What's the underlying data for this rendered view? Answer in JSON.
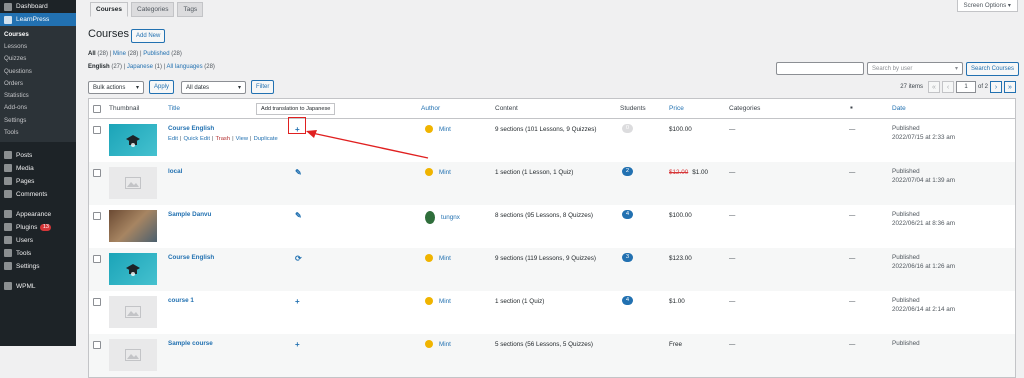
{
  "sidebar": {
    "top": [
      {
        "label": "Dashboard",
        "icon": "dashboard-icon"
      },
      {
        "label": "LearnPress",
        "icon": "graduation-cap-icon",
        "active": true
      }
    ],
    "sub": [
      "Courses",
      "Lessons",
      "Quizzes",
      "Questions",
      "Orders",
      "Statistics",
      "Add-ons",
      "Settings",
      "Tools"
    ],
    "bottom1": [
      {
        "label": "Posts",
        "icon": "pin-icon"
      },
      {
        "label": "Media",
        "icon": "media-icon"
      },
      {
        "label": "Pages",
        "icon": "pages-icon"
      },
      {
        "label": "Comments",
        "icon": "comments-icon"
      }
    ],
    "bottom2": [
      {
        "label": "Appearance",
        "icon": "brush-icon"
      },
      {
        "label": "Plugins",
        "icon": "plugin-icon",
        "badge": "13"
      },
      {
        "label": "Users",
        "icon": "users-icon"
      },
      {
        "label": "Tools",
        "icon": "wrench-icon"
      },
      {
        "label": "Settings",
        "icon": "settings-icon"
      }
    ],
    "bottom3": [
      {
        "label": "WPML",
        "icon": "wpml-icon"
      }
    ]
  },
  "tabs": [
    "Courses",
    "Categories",
    "Tags"
  ],
  "screen_options": "Screen Options ▾",
  "page_title": "Courses",
  "add_new": "Add New",
  "filters": {
    "status": [
      {
        "label": "All",
        "count": "(28)"
      },
      {
        "label": "Mine",
        "count": "(28)"
      },
      {
        "label": "Published",
        "count": "(28)"
      }
    ],
    "language": [
      {
        "label": "English",
        "count": "(27)"
      },
      {
        "label": "Japanese",
        "count": "(1)"
      },
      {
        "label": "All languages",
        "count": "(28)"
      }
    ],
    "separator": "|"
  },
  "bulk_actions": "Bulk actions",
  "apply": "Apply",
  "all_dates": "All dates",
  "filter": "Filter",
  "search": {
    "placeholder": "",
    "user_placeholder": "Search by user",
    "button": "Search Courses"
  },
  "pagination": {
    "items": "27 items",
    "first": "«",
    "prev": "‹",
    "current": "1",
    "of": "of 2",
    "next": "›",
    "last": "»"
  },
  "columns": {
    "thumbnail": "Thumbnail",
    "title": "Title",
    "author": "Author",
    "content": "Content",
    "students": "Students",
    "price": "Price",
    "categories": "Categories",
    "date": "Date"
  },
  "tooltip": "Add translation to Japanese",
  "row_actions": {
    "edit": "Edit",
    "quick_edit": "Quick Edit",
    "trash": "Trash",
    "view": "View",
    "duplicate": "Duplicate",
    "sep": "|"
  },
  "rows": [
    {
      "thumb": "teal",
      "title": "Course English",
      "lang": "+",
      "author": "Mint",
      "content": "9 sections (101 Lessons, 9 Quizzes)",
      "students": "0",
      "price": "$100.00",
      "old_price": "",
      "categories": "—",
      "comments": "—",
      "status": "Published",
      "date": "2022/07/15 at 2:33 am"
    },
    {
      "thumb": "placeholder",
      "title": "local",
      "lang": "✎",
      "author": "Mint",
      "content": "1 section (1 Lesson, 1 Quiz)",
      "students": "2",
      "price": "$1.00",
      "old_price": "$12.00",
      "categories": "—",
      "comments": "—",
      "status": "Published",
      "date": "2022/07/04 at 1:39 am"
    },
    {
      "thumb": "photo",
      "title": "Sample Danvu",
      "lang": "✎",
      "author": "tungnx",
      "content": "8 sections (95 Lessons, 8 Quizzes)",
      "students": "4",
      "price": "$100.00",
      "old_price": "",
      "categories": "—",
      "comments": "—",
      "status": "Published",
      "date": "2022/06/21 at 8:36 am"
    },
    {
      "thumb": "teal",
      "title": "Course English",
      "lang": "⟳",
      "author": "Mint",
      "content": "9 sections (119 Lessons, 9 Quizzes)",
      "students": "3",
      "price": "$123.00",
      "old_price": "",
      "categories": "—",
      "comments": "—",
      "status": "Published",
      "date": "2022/06/16 at 1:26 am"
    },
    {
      "thumb": "placeholder",
      "title": "course 1",
      "lang": "+",
      "author": "Mint",
      "content": "1 section (1 Quiz)",
      "students": "4",
      "price": "$1.00",
      "old_price": "",
      "categories": "—",
      "comments": "—",
      "status": "Published",
      "date": "2022/06/14 at 2:14 am"
    },
    {
      "thumb": "placeholder",
      "title": "Sample course",
      "lang": "+",
      "author": "Mint",
      "content": "5 sections (56 Lessons, 5 Quizzes)",
      "students": "",
      "price": "Free",
      "old_price": "",
      "categories": "—",
      "comments": "—",
      "status": "Published",
      "date": ""
    }
  ]
}
